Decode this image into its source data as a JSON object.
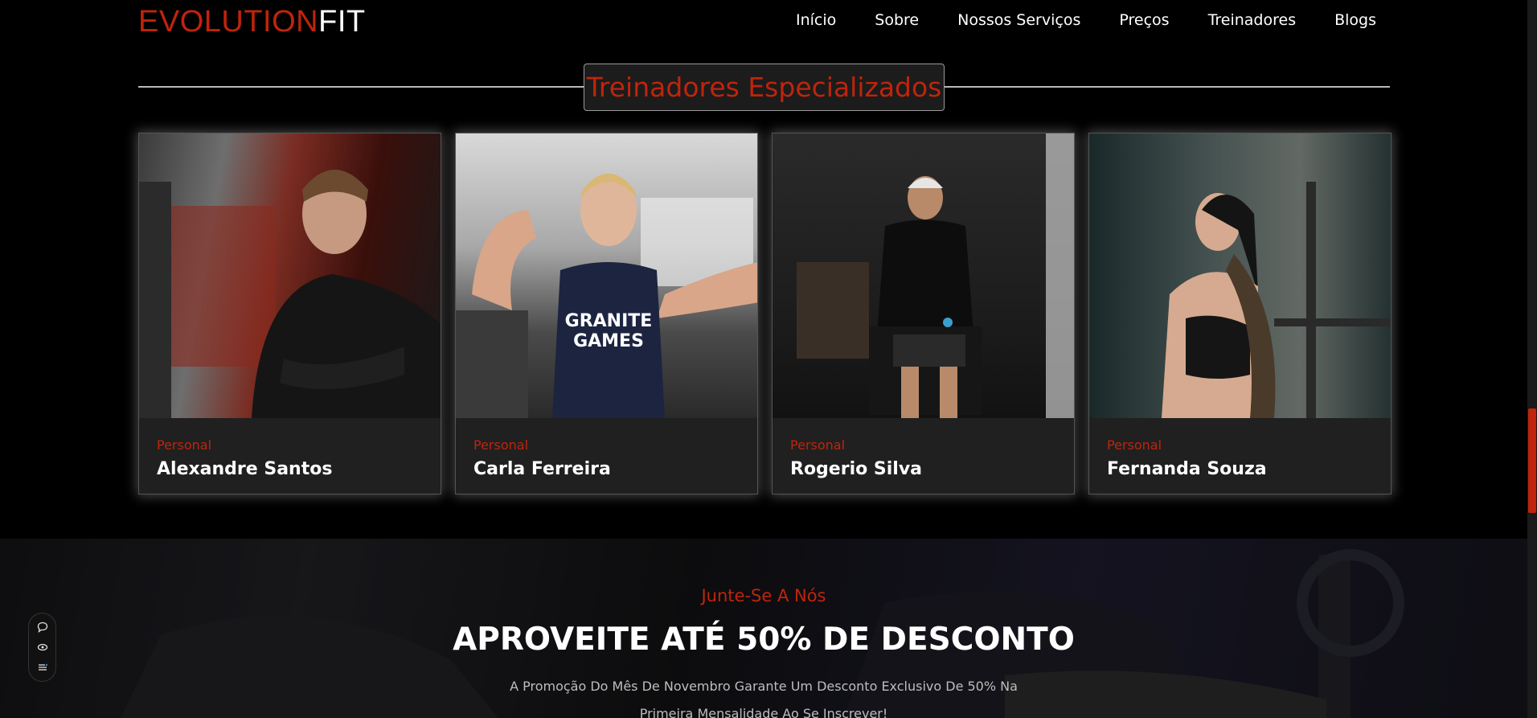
{
  "header": {
    "logo_part1": "EVOLUTION",
    "logo_part2": "FIT",
    "nav": [
      "Início",
      "Sobre",
      "Nossos Serviços",
      "Preços",
      "Treinadores",
      "Blogs"
    ]
  },
  "section": {
    "title": "Treinadores Especializados"
  },
  "trainers": [
    {
      "role": "Personal",
      "name": "Alexandre Santos"
    },
    {
      "role": "Personal",
      "name": "Carla Ferreira"
    },
    {
      "role": "Personal",
      "name": "Rogerio Silva"
    },
    {
      "role": "Personal",
      "name": "Fernanda Souza"
    }
  ],
  "promo": {
    "eyebrow": "Junte-Se A Nós",
    "headline": "APROVEITE ATÉ 50% DE DESCONTO",
    "description": "A Promoção Do Mês De Novembro Garante Um Desconto Exclusivo De 50% Na Primeira Mensalidade Ao Se Inscrever!"
  },
  "widget": {
    "icons": [
      "chat-icon",
      "eye-icon",
      "list-settings-icon"
    ]
  },
  "colors": {
    "accent": "#c0240c",
    "background": "#000000",
    "card": "#202020"
  }
}
